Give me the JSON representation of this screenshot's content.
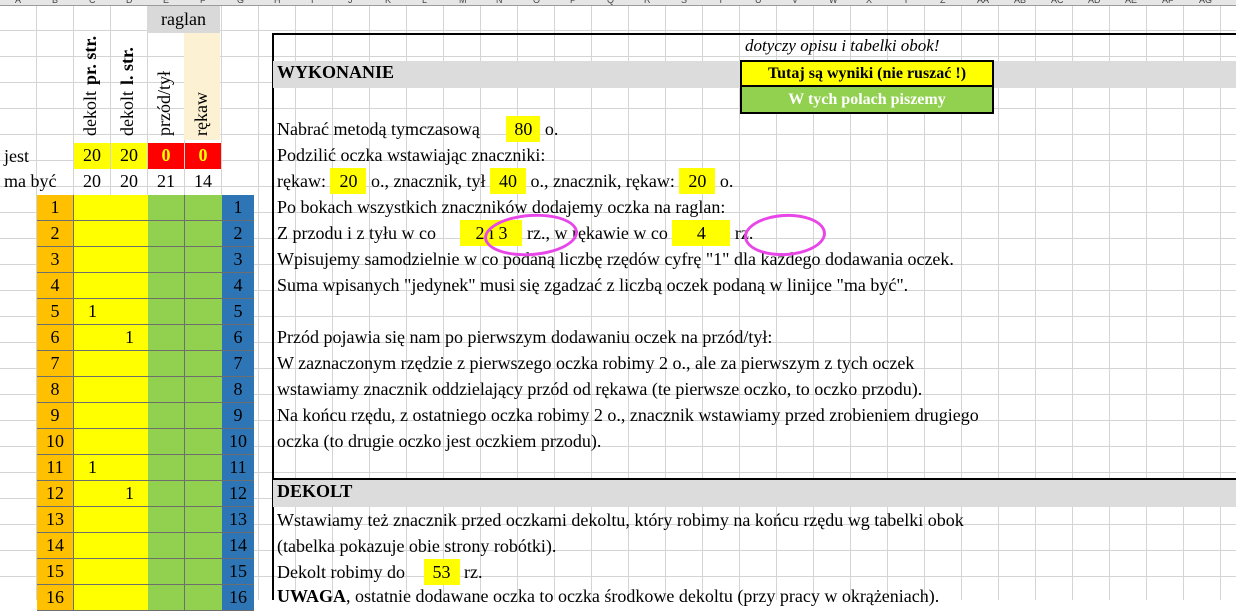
{
  "column_letters": [
    "A",
    "B",
    "C",
    "D",
    "E",
    "F",
    "G",
    "H",
    "I",
    "J",
    "K",
    "L",
    "M",
    "N",
    "O",
    "P",
    "Q",
    "R",
    "S",
    "T",
    "U",
    "V",
    "W",
    "X",
    "Y",
    "Z",
    "AA",
    "AB",
    "AC",
    "AD",
    "AE",
    "AF",
    "AG",
    "AH"
  ],
  "colors": {
    "orange": "#ffc000",
    "yellow": "#ffff00",
    "green": "#92d050",
    "blue": "#2e75b6",
    "red": "#ff0000",
    "header_gray": "#d9d9d9",
    "magenta": "#e846e8"
  },
  "table": {
    "raglan_header": "raglan",
    "col_headers": [
      {
        "pre": "dekolt",
        "bold": "pr. str."
      },
      {
        "pre": "dekolt",
        "bold": "l. str."
      },
      {
        "pre": "przód/tył",
        "bold": ""
      },
      {
        "pre": "rękaw",
        "bold": ""
      }
    ],
    "jest_label": "jest",
    "jest_values": [
      "20",
      "20",
      "0",
      "0"
    ],
    "ma_byc_label": "ma być",
    "ma_byc_values": [
      "20",
      "20",
      "21",
      "14"
    ],
    "rows": [
      {
        "n": "1",
        "c": "",
        "d": ""
      },
      {
        "n": "2",
        "c": "",
        "d": ""
      },
      {
        "n": "3",
        "c": "",
        "d": ""
      },
      {
        "n": "4",
        "c": "",
        "d": ""
      },
      {
        "n": "5",
        "c": "1",
        "d": ""
      },
      {
        "n": "6",
        "c": "",
        "d": "1"
      },
      {
        "n": "7",
        "c": "",
        "d": ""
      },
      {
        "n": "8",
        "c": "",
        "d": ""
      },
      {
        "n": "9",
        "c": "",
        "d": ""
      },
      {
        "n": "10",
        "c": "",
        "d": ""
      },
      {
        "n": "11",
        "c": "1",
        "d": ""
      },
      {
        "n": "12",
        "c": "",
        "d": "1"
      },
      {
        "n": "13",
        "c": "",
        "d": ""
      },
      {
        "n": "14",
        "c": "",
        "d": ""
      },
      {
        "n": "15",
        "c": "",
        "d": ""
      },
      {
        "n": "16",
        "c": "",
        "d": ""
      }
    ]
  },
  "legend": {
    "note": "dotyczy opisu i tabelki obok!",
    "results": "Tutaj są wyniki (nie ruszać !)",
    "input": "W tych polach piszemy"
  },
  "wykonanie": {
    "title": "WYKONANIE",
    "l1_a": "Nabrać metodą tymczasową",
    "l1_val": "80",
    "l1_b": "o.",
    "l2": "Podzilić oczka wstawiając znaczniki:",
    "l3_a": "rękaw:",
    "l3_v1": "20",
    "l3_b": "o., znacznik, tył",
    "l3_v2": "40",
    "l3_c": "o., znacznik, rękaw:",
    "l3_v3": "20",
    "l3_d": "o.",
    "l4": "Po bokach wszystkich znaczników dodajemy oczka na raglan:",
    "l5_a": "Z przodu i z tyłu w co",
    "l5_v1": "2 i 3",
    "l5_b": "rz., w rękawie w co",
    "l5_v2": "4",
    "l5_c": "rz.",
    "l6": "Wpisujemy samodzielnie w co podaną liczbę rzędów cyfrę \"1\" dla każdego dodawania oczek.",
    "l7": "Suma wpisanych \"jedynek\" musi się zgadzać z liczbą oczek podaną w linijce \"ma być\".",
    "l8": "Przód pojawia się nam po pierwszym dodawaniu oczek na przód/tył:",
    "l9": "W zaznaczonym rzędzie z pierwszego oczka robimy 2 o., ale za pierwszym z tych oczek",
    "l10": "wstawiamy znacznik oddzielający przód od rękawa (te pierwsze oczko, to oczko przodu).",
    "l11": "Na końcu rzędu, z ostatniego oczka robimy 2 o., znacznik wstawiamy przed zrobieniem drugiego",
    "l12": "oczka (to drugie oczko jest oczkiem przodu)."
  },
  "dekolt": {
    "title": "DEKOLT",
    "l1": "Wstawiamy też znacznik przed oczkami dekoltu, który robimy na końcu rzędu wg tabelki obok",
    "l2": "(tabelka pokazuje obie strony robótki).",
    "l3_a": "Dekolt robimy do",
    "l3_val": "53",
    "l3_b": "rz.",
    "l4_bold": "UWAGA",
    "l4_rest": ", ostatnie dodawane oczka to oczka środkowe dekoltu (przy pracy w okrążeniach)."
  }
}
